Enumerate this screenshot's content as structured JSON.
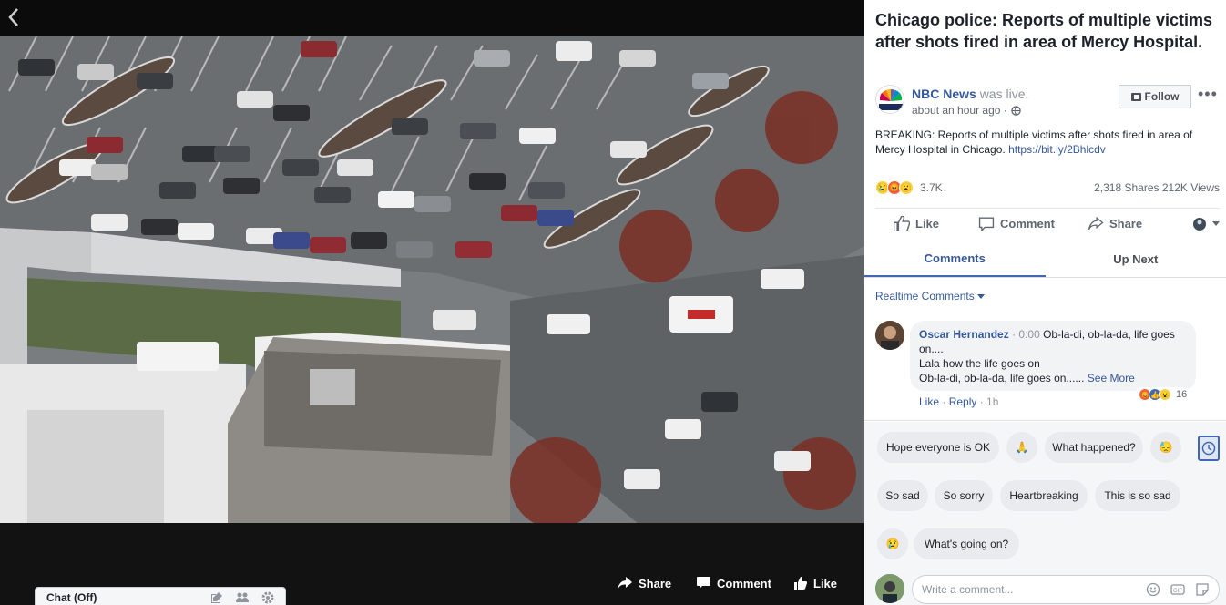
{
  "video": {
    "actions": {
      "share": "Share",
      "comment": "Comment",
      "like": "Like"
    },
    "chat": {
      "label": "Chat (Off)"
    }
  },
  "post": {
    "title": "Chicago police: Reports of multiple victims after shots fired in area of Mercy Hospital.",
    "page_name": "NBC News",
    "was_live": "was live.",
    "time": "about an hour ago ·",
    "follow": "Follow",
    "text": "BREAKING: Reports of multiple victims after shots fired in area of Mercy Hospital in Chicago.",
    "link": "https://bit.ly/2Bhlcdv",
    "reaction_count": "3.7K",
    "stats": "2,318 Shares  212K Views"
  },
  "actions": {
    "like": "Like",
    "comment": "Comment",
    "share": "Share"
  },
  "tabs": {
    "comments": "Comments",
    "up_next": "Up Next"
  },
  "comments": {
    "filter": "Realtime Comments",
    "items": [
      {
        "author": "Oscar Hernandez",
        "time": "· 0:00",
        "line1": "Ob-la-di, ob-la-da, life goes on....",
        "line2": "Lala how the life goes on",
        "line3": "Ob-la-di, ob-la-da, life goes on......",
        "see_more": "See More",
        "reactions": "16",
        "like": "Like",
        "reply": "Reply",
        "age": "1h"
      }
    ]
  },
  "quick_replies": [
    "Hope everyone is OK",
    "What happened?",
    "So sad",
    "So sorry",
    "Heartbreaking",
    "This is so sad",
    "What's going on?"
  ],
  "composer": {
    "placeholder": "Write a comment..."
  },
  "colors": {
    "link": "#365899",
    "accent": "#4267b2",
    "video_bg": "#121212"
  }
}
